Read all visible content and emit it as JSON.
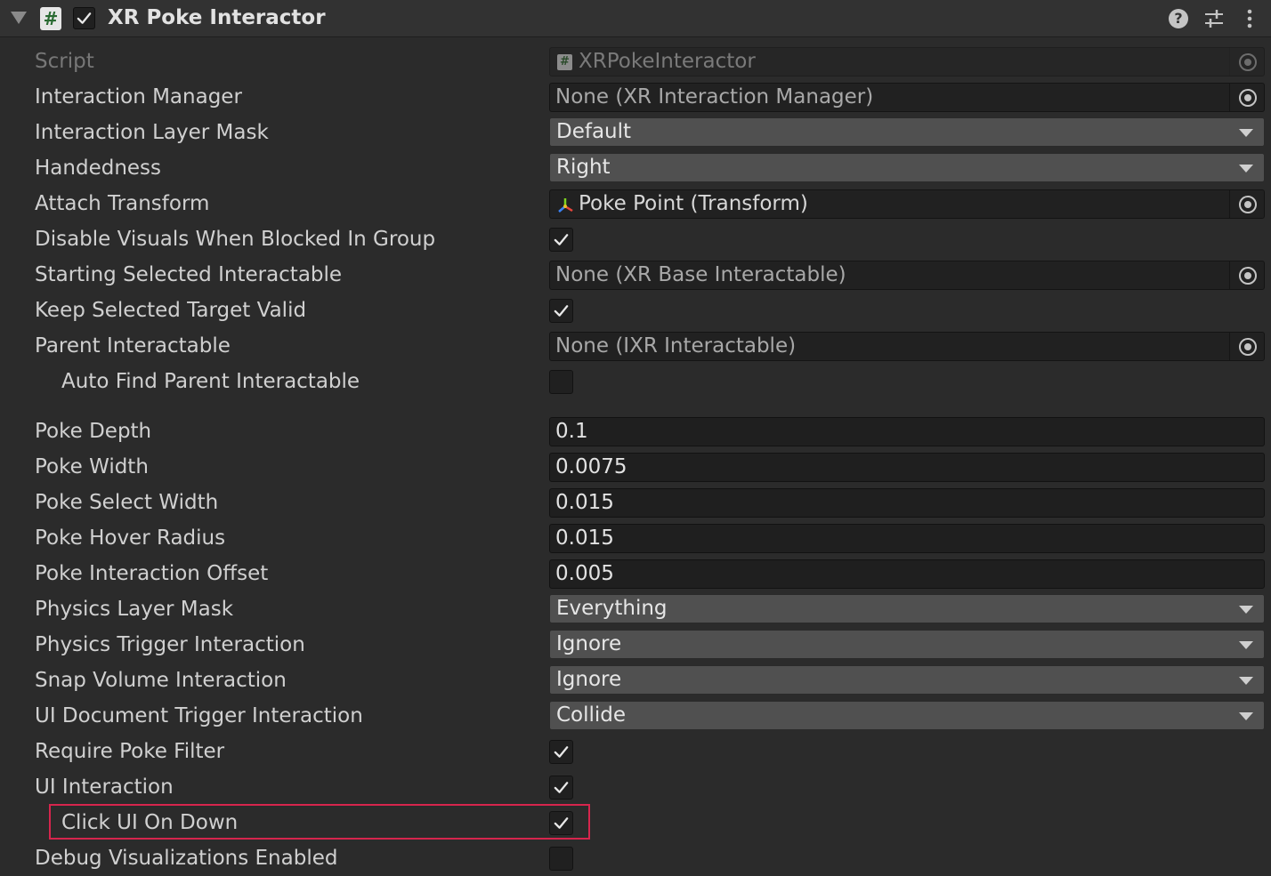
{
  "header": {
    "title": "XR Poke Interactor",
    "script_icon": "#",
    "enabled": true
  },
  "fields": {
    "script": {
      "label": "Script",
      "value": "XRPokeInteractor"
    },
    "interaction_manager": {
      "label": "Interaction Manager",
      "value": "None (XR Interaction Manager)"
    },
    "interaction_layer_mask": {
      "label": "Interaction Layer Mask",
      "value": "Default"
    },
    "handedness": {
      "label": "Handedness",
      "value": "Right"
    },
    "attach_transform": {
      "label": "Attach Transform",
      "value": "Poke Point (Transform)"
    },
    "disable_visuals": {
      "label": "Disable Visuals When Blocked In Group",
      "checked": true
    },
    "starting_selected": {
      "label": "Starting Selected Interactable",
      "value": "None (XR Base Interactable)"
    },
    "keep_selected": {
      "label": "Keep Selected Target Valid",
      "checked": true
    },
    "parent_interactable": {
      "label": "Parent Interactable",
      "value": "None (IXR Interactable)"
    },
    "auto_find_parent": {
      "label": "Auto Find Parent Interactable",
      "checked": false
    },
    "poke_depth": {
      "label": "Poke Depth",
      "value": "0.1"
    },
    "poke_width": {
      "label": "Poke Width",
      "value": "0.0075"
    },
    "poke_select_width": {
      "label": "Poke Select Width",
      "value": "0.015"
    },
    "poke_hover_radius": {
      "label": "Poke Hover Radius",
      "value": "0.015"
    },
    "poke_interaction_offset": {
      "label": "Poke Interaction Offset",
      "value": "0.005"
    },
    "physics_layer_mask": {
      "label": "Physics Layer Mask",
      "value": "Everything"
    },
    "physics_trigger": {
      "label": "Physics Trigger Interaction",
      "value": "Ignore"
    },
    "snap_volume": {
      "label": "Snap Volume Interaction",
      "value": "Ignore"
    },
    "ui_document_trigger": {
      "label": "UI Document Trigger Interaction",
      "value": "Collide"
    },
    "require_poke_filter": {
      "label": "Require Poke Filter",
      "checked": true
    },
    "ui_interaction": {
      "label": "UI Interaction",
      "checked": true
    },
    "click_ui_on_down": {
      "label": "Click UI On Down",
      "checked": true
    },
    "debug_visualizations": {
      "label": "Debug Visualizations Enabled",
      "checked": false
    }
  },
  "colors": {
    "highlight": "#d6254d",
    "background": "#2b2b2b"
  },
  "icons": {
    "foldout": "triangle-down-icon",
    "help": "help-icon",
    "presets": "sliders-icon",
    "menu": "kebab-menu-icon",
    "object_picker": "target-icon",
    "transform": "transform-axes-icon"
  }
}
